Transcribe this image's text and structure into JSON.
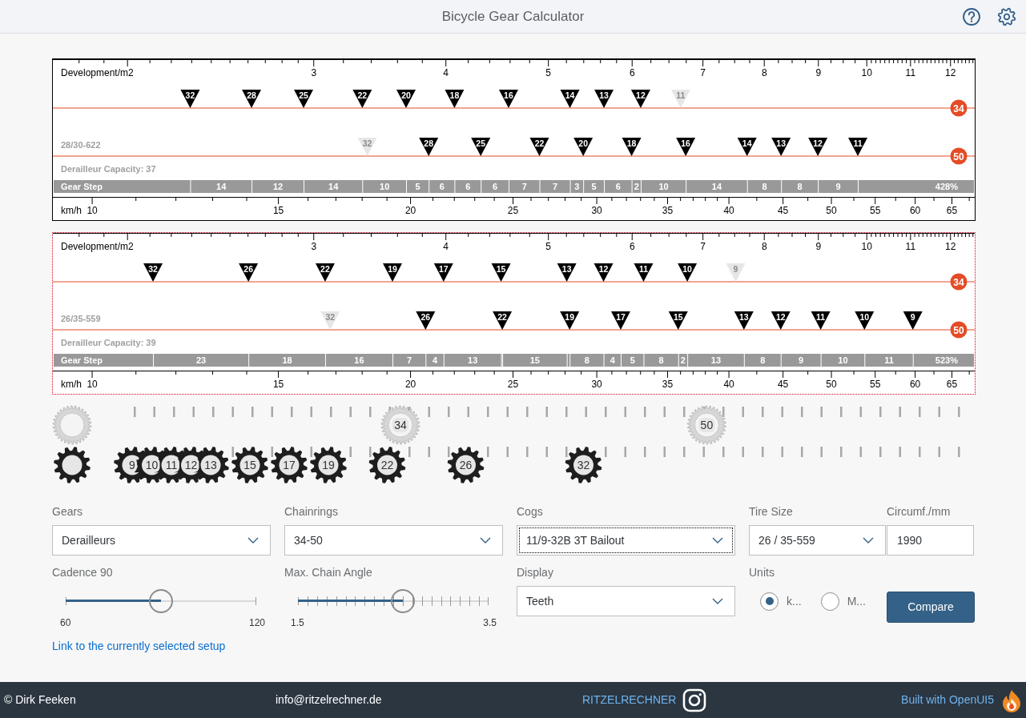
{
  "header": {
    "title": "Bicycle Gear Calculator"
  },
  "charts": [
    {
      "selected": false,
      "axis_title": "Development/m2",
      "axis_ticks": [
        "3",
        "4",
        "5",
        "6",
        "7",
        "8",
        "9",
        "10",
        "11",
        "12"
      ],
      "rows": [
        {
          "ring": "34",
          "cogs": [
            {
              "label": "32",
              "disabled": false
            },
            {
              "label": "28",
              "disabled": false
            },
            {
              "label": "25",
              "disabled": false
            },
            {
              "label": "22",
              "disabled": false
            },
            {
              "label": "20",
              "disabled": false
            },
            {
              "label": "18",
              "disabled": false
            },
            {
              "label": "16",
              "disabled": false
            },
            {
              "label": "14",
              "disabled": false
            },
            {
              "label": "13",
              "disabled": false
            },
            {
              "label": "12",
              "disabled": false
            },
            {
              "label": "11",
              "disabled": true
            }
          ]
        },
        {
          "ring": "50",
          "cogs": [
            {
              "label": "32",
              "disabled": true
            },
            {
              "label": "28",
              "disabled": false
            },
            {
              "label": "25",
              "disabled": false
            },
            {
              "label": "22",
              "disabled": false
            },
            {
              "label": "20",
              "disabled": false
            },
            {
              "label": "18",
              "disabled": false
            },
            {
              "label": "16",
              "disabled": false
            },
            {
              "label": "14",
              "disabled": false
            },
            {
              "label": "13",
              "disabled": false
            },
            {
              "label": "12",
              "disabled": false
            },
            {
              "label": "11",
              "disabled": false
            }
          ]
        }
      ],
      "tire": "28/30-622",
      "capacity": "Derailleur Capacity: 37",
      "gear_step_title": "Gear Step",
      "gear_steps": [
        "14",
        "12",
        "14",
        "10",
        "5",
        "6",
        "6",
        "6",
        "7",
        "7",
        "3",
        "5",
        "6",
        "2",
        "10",
        "14",
        "8",
        "8",
        "9"
      ],
      "range": "428%",
      "speed_title": "km/h",
      "speed_ticks": [
        "10",
        "15",
        "20",
        "25",
        "30",
        "35",
        "40",
        "45",
        "50",
        "55",
        "60",
        "65"
      ]
    },
    {
      "selected": true,
      "axis_title": "Development/m2",
      "axis_ticks": [
        "3",
        "4",
        "5",
        "6",
        "7",
        "8",
        "9",
        "10",
        "11",
        "12"
      ],
      "rows": [
        {
          "ring": "34",
          "cogs": [
            {
              "label": "32",
              "disabled": false
            },
            {
              "label": "26",
              "disabled": false
            },
            {
              "label": "22",
              "disabled": false
            },
            {
              "label": "19",
              "disabled": false
            },
            {
              "label": "17",
              "disabled": false
            },
            {
              "label": "15",
              "disabled": false
            },
            {
              "label": "13",
              "disabled": false
            },
            {
              "label": "12",
              "disabled": false
            },
            {
              "label": "11",
              "disabled": false
            },
            {
              "label": "10",
              "disabled": false
            },
            {
              "label": "9",
              "disabled": true
            }
          ]
        },
        {
          "ring": "50",
          "cogs": [
            {
              "label": "32",
              "disabled": true
            },
            {
              "label": "26",
              "disabled": false
            },
            {
              "label": "22",
              "disabled": false
            },
            {
              "label": "19",
              "disabled": false
            },
            {
              "label": "17",
              "disabled": false
            },
            {
              "label": "15",
              "disabled": false
            },
            {
              "label": "13",
              "disabled": false
            },
            {
              "label": "12",
              "disabled": false
            },
            {
              "label": "11",
              "disabled": false
            },
            {
              "label": "10",
              "disabled": false
            },
            {
              "label": "9",
              "disabled": false
            }
          ]
        }
      ],
      "tire": "26/35-559",
      "capacity": "Derailleur Capacity: 39",
      "gear_step_title": "Gear Step",
      "gear_steps": [
        "23",
        "18",
        "16",
        "7",
        "4",
        "13",
        "15",
        "8",
        "4",
        "5",
        "8",
        "2",
        "13",
        "8",
        "9",
        "10",
        "11"
      ],
      "range": "523%",
      "speed_title": "km/h",
      "speed_ticks": [
        "10",
        "15",
        "20",
        "25",
        "30",
        "35",
        "40",
        "45",
        "50",
        "55",
        "60",
        "65"
      ]
    }
  ],
  "sprockets": {
    "chainrings": [
      "34",
      "50"
    ],
    "cogs": [
      "9",
      "10",
      "11",
      "12",
      "13",
      "15",
      "17",
      "19",
      "22",
      "26",
      "32"
    ]
  },
  "form": {
    "gears": {
      "label": "Gears",
      "value": "Derailleurs",
      "focused": false
    },
    "chainrings": {
      "label": "Chainrings",
      "value": "34-50",
      "focused": false
    },
    "cogs": {
      "label": "Cogs",
      "value": "11/9-32B 3T Bailout",
      "focused": true
    },
    "tire_size": {
      "label": "Tire Size",
      "value": "26 / 35-559",
      "focused": false
    },
    "circumference": {
      "label": "Circumf./mm",
      "value": "1990"
    },
    "cadence": {
      "label": "Cadence 90",
      "level": 0.5,
      "min": "60",
      "max": "120"
    },
    "chain_angle": {
      "label": "Max. Chain Angle",
      "level": 0.55,
      "min": "1.5",
      "max": "3.5"
    },
    "display": {
      "label": "Display",
      "value": "Teeth",
      "focused": false
    },
    "units": {
      "label": "Units",
      "options": [
        {
          "label": "k...",
          "selected": true
        },
        {
          "label": "M...",
          "selected": false
        }
      ]
    },
    "compare": "Compare",
    "link": "Link to the currently selected setup"
  },
  "footer": {
    "author": "© Dirk Feeken",
    "email": "info@ritzelrechner.de",
    "social": "RITZELRECHNER",
    "built_with": "Built with OpenUI5"
  }
}
